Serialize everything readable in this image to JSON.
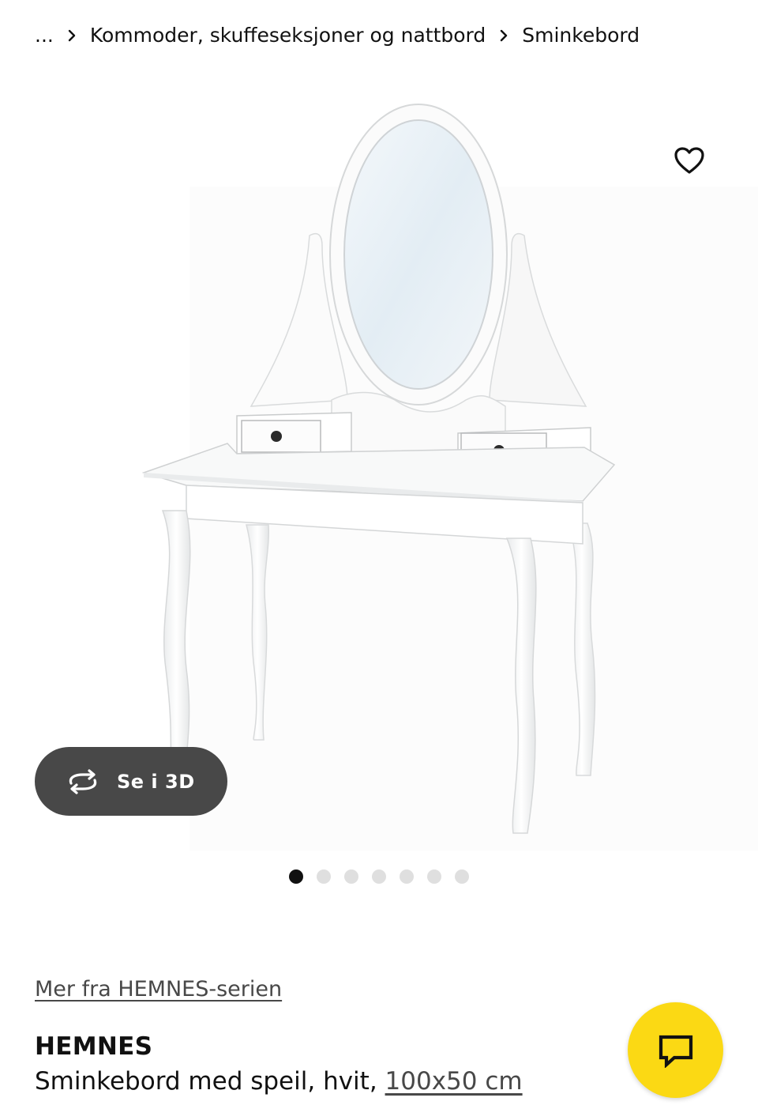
{
  "breadcrumb": {
    "items": [
      {
        "label": "..."
      },
      {
        "label": "Kommoder, skuffeseksjoner og nattbord"
      },
      {
        "label": "Sminkebord"
      }
    ]
  },
  "gallery": {
    "button_3d_label": "Se i 3D",
    "slide_count": 7,
    "active_slide": 1,
    "favorite_icon": "heart-outline-icon",
    "rotate_icon": "rotate-3d-icon"
  },
  "product": {
    "series_link": "Mer fra HEMNES-serien",
    "name": "HEMNES",
    "description": "Sminkebord med speil, hvit, ",
    "size": "100x50 cm"
  },
  "chat": {
    "icon": "chat-bubble-icon",
    "color": "#fbd914"
  },
  "colors": {
    "text": "#111111",
    "muted": "#484848",
    "button_3d_bg": "#484848",
    "dot_inactive": "#dfdfdf"
  }
}
